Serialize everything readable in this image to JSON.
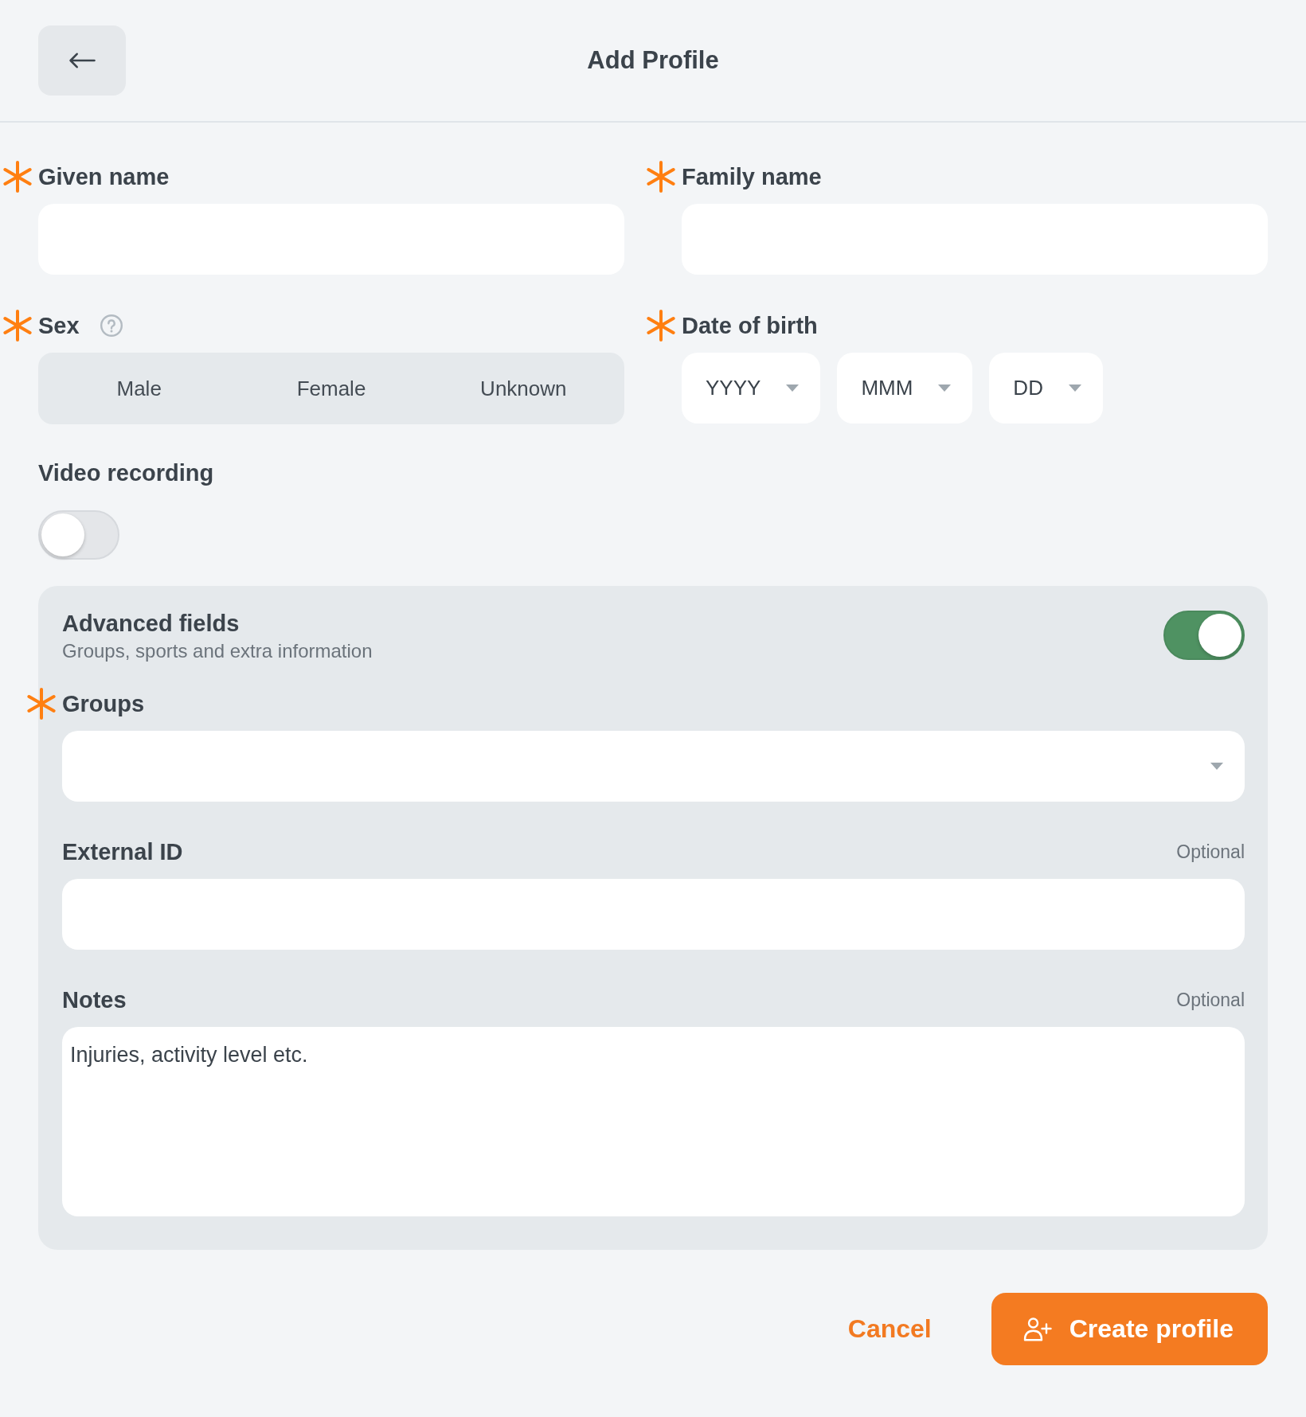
{
  "header": {
    "title": "Add Profile"
  },
  "fields": [
    {
      "kind": "text",
      "label": "Given name",
      "required": true
    },
    {
      "kind": "text",
      "label": "Family name",
      "required": true
    },
    {
      "kind": "segmented",
      "label": "Sex",
      "required": true,
      "help": true,
      "options": [
        {
          "label": "Male",
          "selected": false
        },
        {
          "label": "Female",
          "selected": false
        },
        {
          "label": "Unknown",
          "selected": false
        }
      ]
    },
    {
      "kind": "date",
      "label": "Date of birth",
      "required": true,
      "parts": [
        {
          "placeholder": "YYYY"
        },
        {
          "placeholder": "MMM"
        },
        {
          "placeholder": "DD"
        }
      ]
    }
  ],
  "video_recording": {
    "label": "Video recording",
    "on": false
  },
  "advanced": {
    "title": "Advanced fields",
    "subtitle": "Groups, sports and extra information",
    "on": true,
    "fields": [
      {
        "kind": "select",
        "label": "Groups",
        "required": true
      },
      {
        "kind": "text",
        "label": "External ID",
        "required": false,
        "note": "Optional"
      },
      {
        "kind": "textarea",
        "label": "Notes",
        "required": false,
        "note": "Optional",
        "placeholder": "Injuries, activity level etc."
      }
    ]
  },
  "actions": {
    "cancel": "Cancel",
    "submit": "Create profile"
  }
}
